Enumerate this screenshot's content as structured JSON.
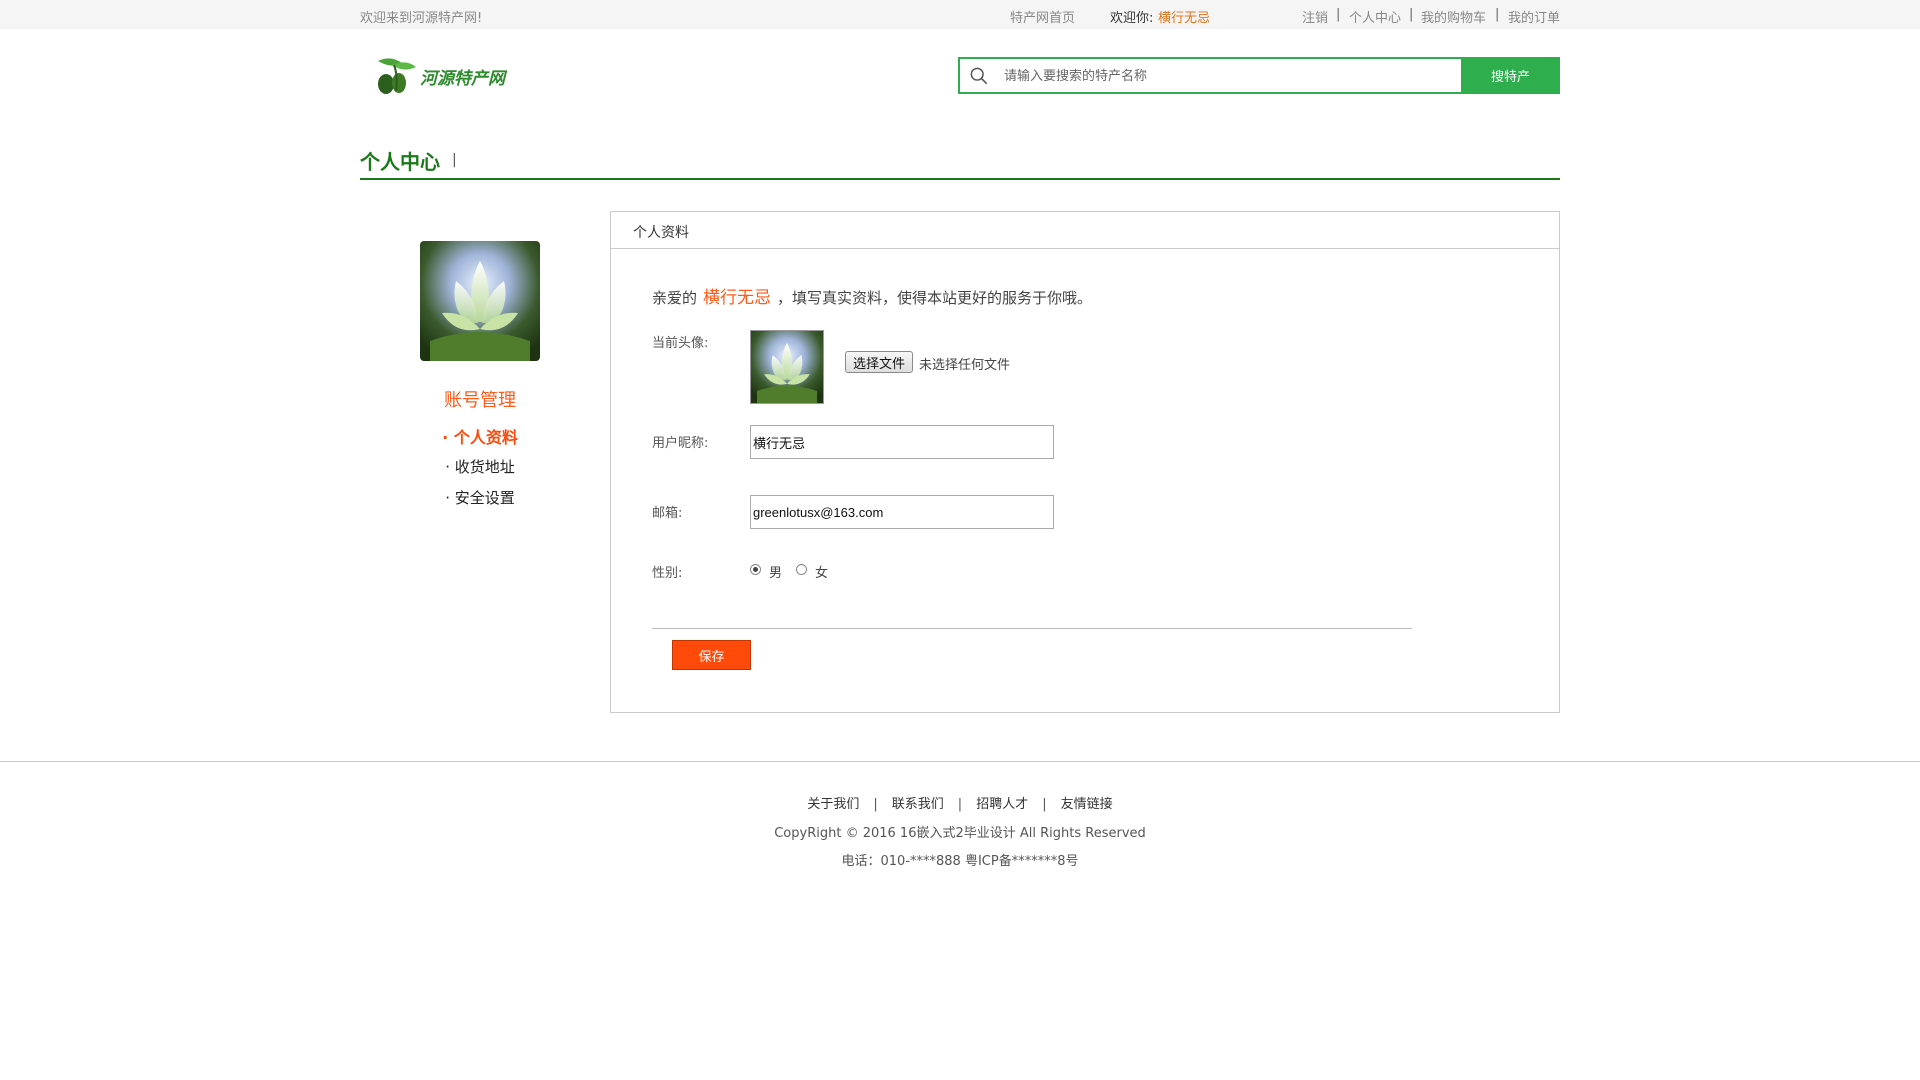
{
  "topbar": {
    "welcome": "欢迎来到河源特产网!",
    "home": "特产网首页",
    "hello_label": "欢迎你:",
    "username": "横行无忌",
    "logout": "注销",
    "center": "个人中心",
    "cart": "我的购物车",
    "orders": "我的订单",
    "separator": "|"
  },
  "header": {
    "logo_text": "河源特产网",
    "search_placeholder": "请输入要搜索的特产名称",
    "search_button": "搜特产",
    "brand_color": "#2fae4d"
  },
  "section": {
    "title": "个人中心",
    "bar": "|"
  },
  "sidebar": {
    "heading": "账号管理",
    "items": [
      {
        "label": "· 个人资料",
        "active": true
      },
      {
        "label": "· 收货地址",
        "active": false
      },
      {
        "label": "· 安全设置",
        "active": false
      }
    ]
  },
  "panel": {
    "title": "个人资料",
    "greet_prefix": "亲爱的",
    "greet_name": "横行无忌",
    "greet_suffix": "，填写真实资料，使得本站更好的服务于你哦。",
    "avatar_label": "当前头像:",
    "file_button": "选择文件",
    "file_status": "未选择任何文件",
    "nickname_label": "用户昵称:",
    "nickname_value": "横行无忌",
    "email_label": "邮箱:",
    "email_value": "greenlotusx@163.com",
    "gender_label": "性别:",
    "gender_options": [
      "男",
      "女"
    ],
    "gender_selected": "男",
    "save_button": "保存",
    "accent_color": "#ff4a0a"
  },
  "footer": {
    "links": [
      "关于我们",
      "联系我们",
      "招聘人才",
      "友情链接"
    ],
    "separator": "|",
    "copyright": "CopyRight © 2016 16嵌入式2毕业设计 All Rights Reserved",
    "tel": "电话：010-****888 粤ICP备*******8号"
  }
}
